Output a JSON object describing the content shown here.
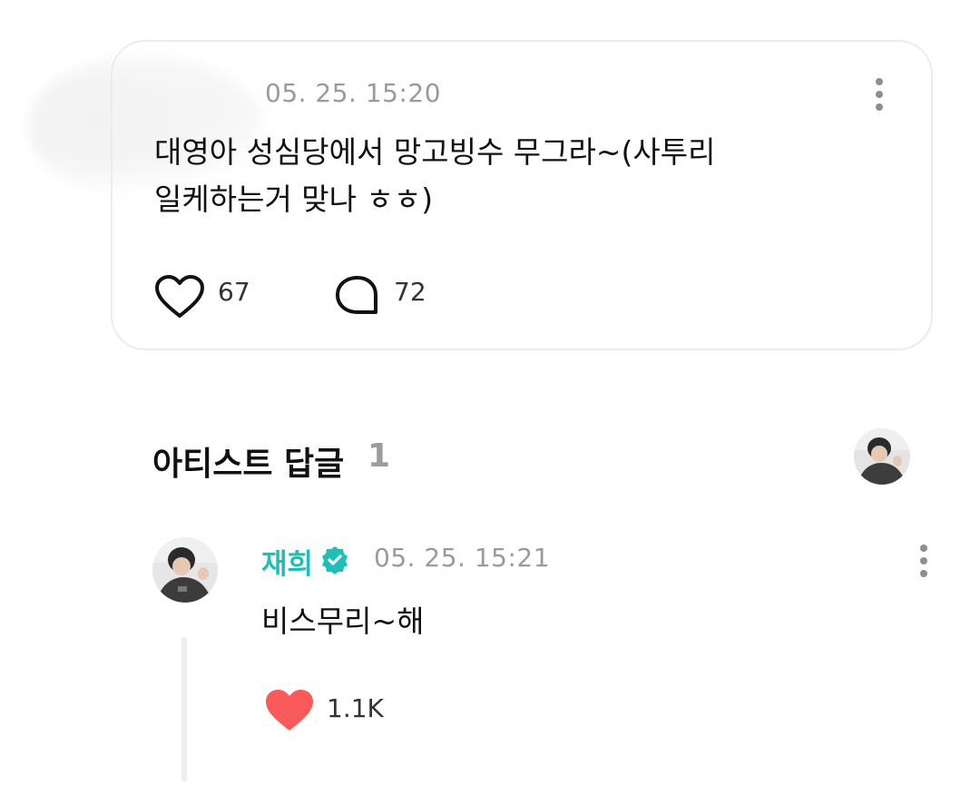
{
  "post": {
    "time": "05. 25. 15:20",
    "text": "대영아 성심당에서 망고빙수 무그라~(사투리\n일케하는거 맞나 ㅎㅎ)",
    "like_count": "67",
    "comment_count": "72"
  },
  "artist_replies": {
    "title": "아티스트 답글",
    "count": "1"
  },
  "reply": {
    "author": "재희",
    "time": "05. 25. 15:21",
    "text": "비스무리~해",
    "like_count": "1.1K"
  },
  "colors": {
    "accent": "#1fbfb8",
    "heart": "#fa5a5a",
    "verified": "#1fbfb8"
  },
  "icons": {
    "like": "heart-outline-icon",
    "comment": "speech-bubble-icon",
    "more": "vertical-ellipsis-icon",
    "verified": "verified-badge-icon",
    "reply_like": "heart-filled-icon"
  }
}
